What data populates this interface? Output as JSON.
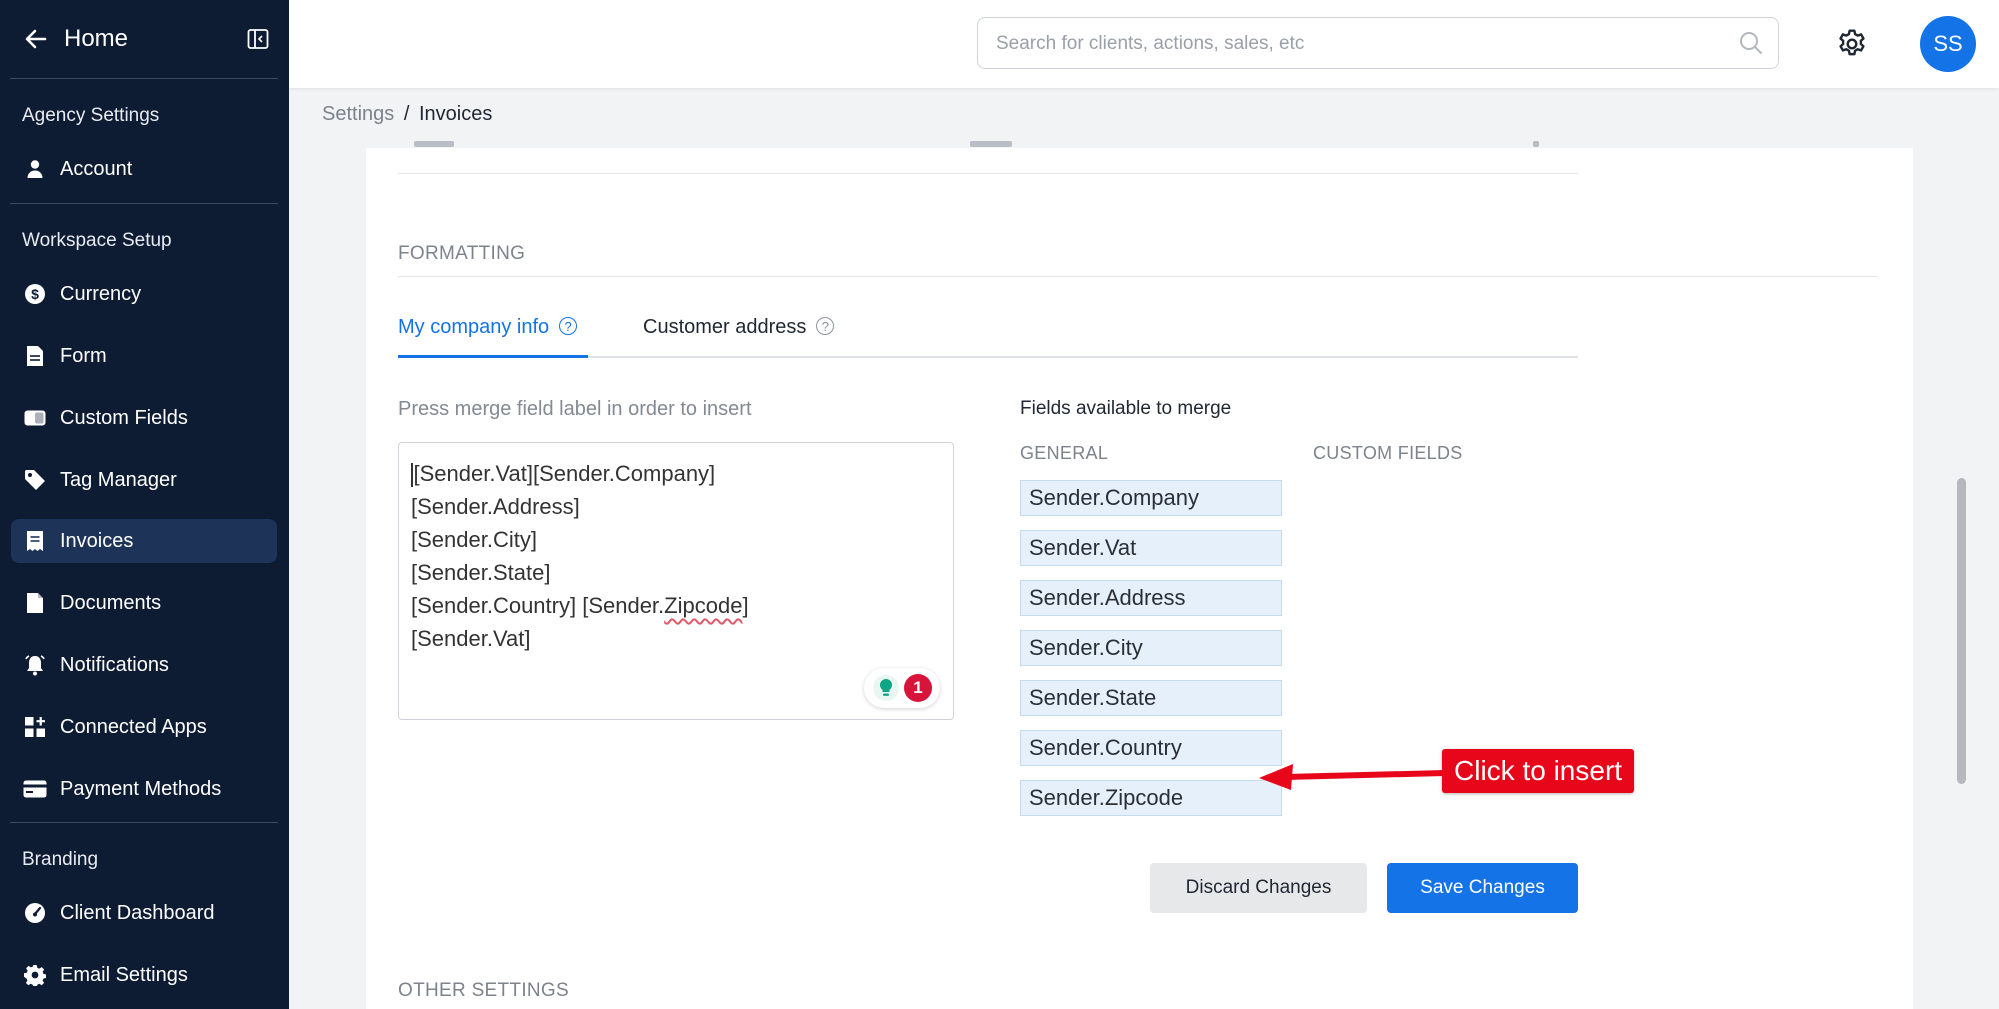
{
  "sidebar": {
    "home_label": "Home",
    "sections": {
      "agency": "Agency Settings",
      "workspace": "Workspace Setup",
      "branding": "Branding"
    },
    "items": [
      {
        "label": "Account",
        "icon": "user-icon"
      },
      {
        "label": "Currency",
        "icon": "dollar-icon"
      },
      {
        "label": "Form",
        "icon": "document-icon"
      },
      {
        "label": "Custom Fields",
        "icon": "toggle-icon"
      },
      {
        "label": "Tag Manager",
        "icon": "tag-icon"
      },
      {
        "label": "Invoices",
        "icon": "receipt-icon",
        "active": true
      },
      {
        "label": "Documents",
        "icon": "file-icon"
      },
      {
        "label": "Notifications",
        "icon": "bell-icon"
      },
      {
        "label": "Connected Apps",
        "icon": "apps-icon"
      },
      {
        "label": "Payment Methods",
        "icon": "card-icon"
      },
      {
        "label": "Client Dashboard",
        "icon": "gauge-icon"
      },
      {
        "label": "Email Settings",
        "icon": "gear-icon"
      }
    ]
  },
  "topbar": {
    "search_placeholder": "Search for clients, actions, sales, etc",
    "avatar_initials": "SS"
  },
  "breadcrumb": {
    "parent": "Settings",
    "separator": "/",
    "current": "Invoices"
  },
  "formatting": {
    "title": "FORMATTING",
    "tabs": [
      {
        "label": "My company info",
        "active": true
      },
      {
        "label": "Customer address",
        "active": false
      }
    ],
    "hint": "Press merge field label in order to insert",
    "editor_lines": [
      "[Sender.Vat][Sender.Company]",
      "[Sender.Address]",
      "[Sender.City]",
      "[Sender.State]",
      "[Sender.Country] [Sender.",
      "[Sender.Vat]"
    ],
    "editor_misspelled": "Zipcode",
    "editor_line5_tail": "]",
    "grammar_count": "1",
    "fields_title": "Fields available to merge",
    "general_label": "GENERAL",
    "custom_label": "CUSTOM FIELDS",
    "fields": [
      "Sender.Company",
      "Sender.Vat",
      "Sender.Address",
      "Sender.City",
      "Sender.State",
      "Sender.Country",
      "Sender.Zipcode"
    ],
    "discard_label": "Discard Changes",
    "save_label": "Save Changes"
  },
  "annotation": {
    "label": "Click to insert",
    "color": "#e8071a"
  },
  "other_settings_title": "OTHER SETTINGS",
  "colors": {
    "sidebar_bg": "#0d1b33",
    "accent": "#1473e6"
  }
}
